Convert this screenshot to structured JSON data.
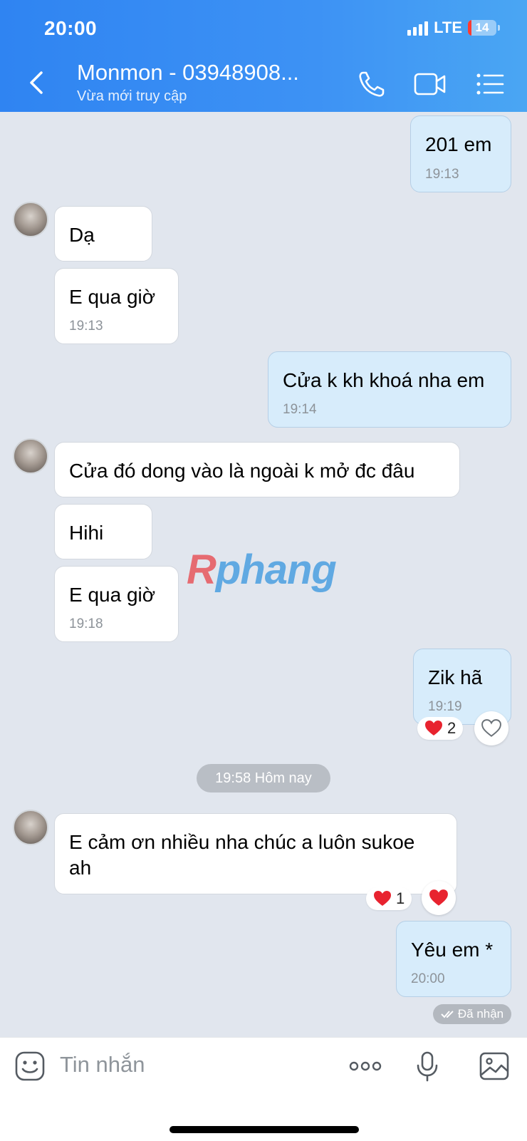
{
  "status_bar": {
    "time": "20:00",
    "network": "LTE",
    "battery": "14"
  },
  "header": {
    "title": "Monmon - 03948908...",
    "subtitle": "Vừa mới truy cập",
    "icons": [
      "back-arrow-icon",
      "phone-icon",
      "video-camera-icon",
      "menu-list-icon"
    ]
  },
  "messages": [
    {
      "direction": "out",
      "text": "201 em",
      "time": "19:13"
    },
    {
      "direction": "in",
      "text": "Dạ",
      "time": ""
    },
    {
      "direction": "in",
      "text": "E qua giờ",
      "time": "19:13"
    },
    {
      "direction": "out",
      "text": "Cửa k kh khoá nha em",
      "time": "19:14"
    },
    {
      "direction": "in",
      "text": "Cửa đó dong vào là ngoài k mở đc đâu",
      "time": ""
    },
    {
      "direction": "in",
      "text": "Hihi",
      "time": ""
    },
    {
      "direction": "in",
      "text": "E qua giờ",
      "time": "19:18"
    },
    {
      "direction": "out",
      "text": "Zik hã",
      "time": "19:19",
      "reaction_count": "2"
    },
    {
      "direction": "in",
      "text": "E cảm ơn nhiều nha chúc a luôn sukoe ah",
      "time": "",
      "reaction_count": "1"
    },
    {
      "direction": "out",
      "text": "Yêu em *",
      "time": "20:00"
    }
  ],
  "date_separator": "19:58 Hôm nay",
  "delivery_status": "Đã nhận",
  "watermark": {
    "first": "R",
    "rest": "phang"
  },
  "input": {
    "placeholder": "Tin nhắn"
  },
  "colors": {
    "header": "#3d92f4",
    "outgoing": "#d7ecfb",
    "incoming": "#ffffff",
    "reaction": "#e8232f"
  }
}
